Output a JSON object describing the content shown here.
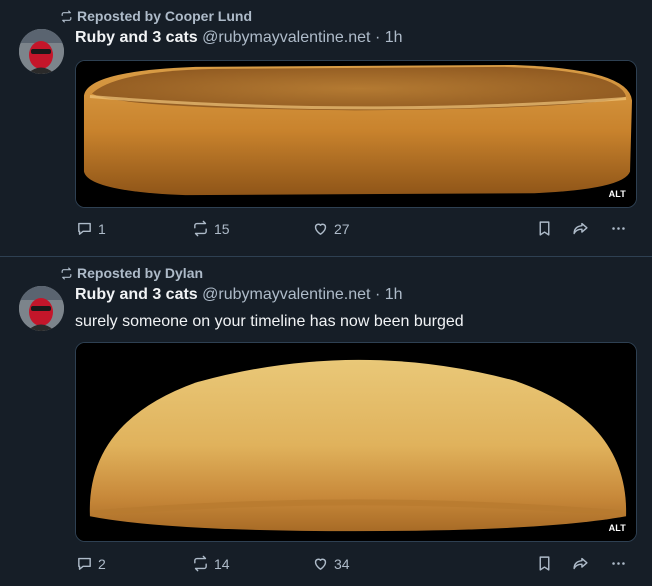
{
  "posts": [
    {
      "repost_label": "Reposted by Cooper Lund",
      "author_name": "Ruby and 3 cats",
      "author_handle": "@rubymayvalentine.net",
      "separator": "·",
      "time": "1h",
      "text": "",
      "alt_label": "ALT",
      "reply_count": "1",
      "repost_count": "15",
      "like_count": "27",
      "icons": [
        "repost-icon",
        "reply-icon",
        "like-icon",
        "bookmark-icon",
        "share-icon",
        "more-icon"
      ]
    },
    {
      "repost_label": "Reposted by Dylan",
      "author_name": "Ruby and 3 cats",
      "author_handle": "@rubymayvalentine.net",
      "separator": "·",
      "time": "1h",
      "text": "surely someone on your timeline has now been burged",
      "alt_label": "ALT",
      "reply_count": "2",
      "repost_count": "14",
      "like_count": "34",
      "icons": [
        "repost-icon",
        "reply-icon",
        "like-icon",
        "bookmark-icon",
        "share-icon",
        "more-icon"
      ]
    }
  ],
  "colors": {
    "background": "#161e27",
    "muted_text": "#aebbc9",
    "divider": "#2e4052"
  }
}
